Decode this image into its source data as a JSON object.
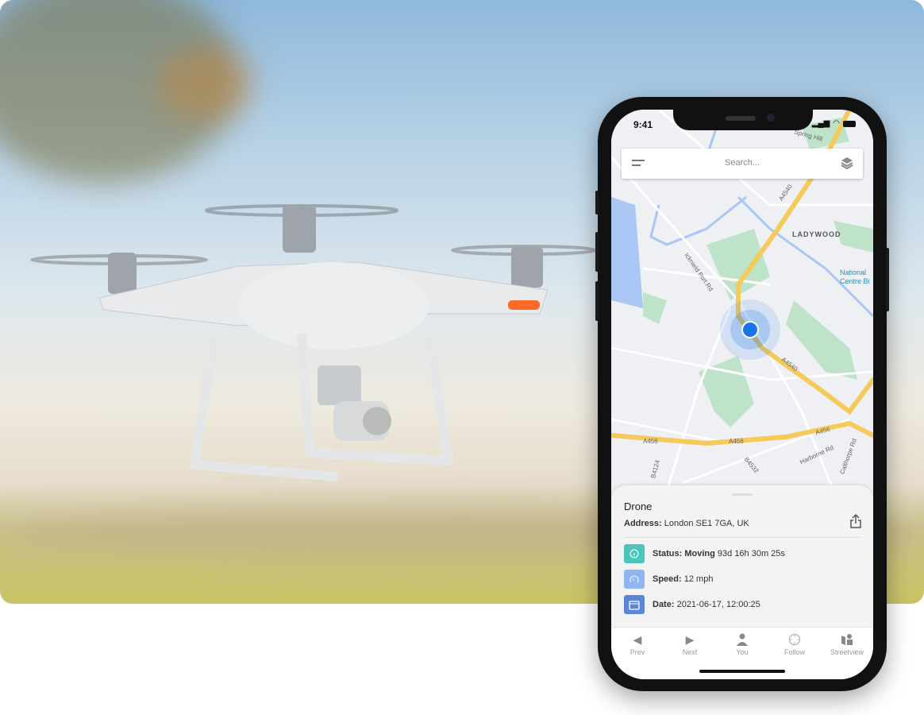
{
  "phone": {
    "status_time": "9:41",
    "search": {
      "placeholder": "Search..."
    },
    "map_labels": {
      "area": "LADYWOOD",
      "poi": "National Centre Bi",
      "top_road": "Spring Hill",
      "road1": "A4540",
      "road1b": "A4540",
      "road2": "A456",
      "road2b": "A456",
      "road2c": "A456",
      "road3": "B4124",
      "road4": "B4532",
      "road5": "Harborne Rd",
      "road6": "Calthorpe Rd",
      "road7": "Icknield Port Rd"
    },
    "panel": {
      "title": "Drone",
      "address_label": "Address:",
      "address_value": "London SE1 7GA, UK",
      "status_label": "Status:",
      "status_value": "Moving",
      "status_duration": "93d 16h 30m 25s",
      "speed_label": "Speed:",
      "speed_value": "12 mph",
      "date_label": "Date:",
      "date_value": "2021-06-17, 12:00:25"
    },
    "nav": [
      {
        "label": "Prev",
        "icon": "triangle-left-icon"
      },
      {
        "label": "Next",
        "icon": "triangle-right-icon"
      },
      {
        "label": "You",
        "icon": "person-icon"
      },
      {
        "label": "Follow",
        "icon": "crosshair-icon"
      },
      {
        "label": "Streetview",
        "icon": "streetview-icon"
      }
    ],
    "colors": {
      "status": "#4cc6bd",
      "speed": "#8fb6f2",
      "date": "#5a86d8",
      "location": "#1a73e8",
      "road": "#f5c95a"
    }
  }
}
